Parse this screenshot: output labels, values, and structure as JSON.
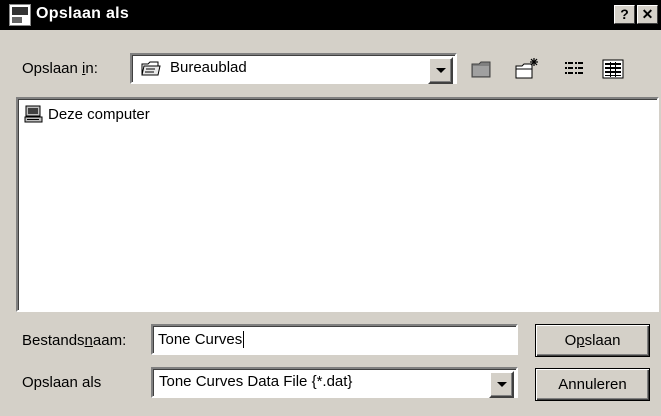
{
  "window": {
    "title": "Opslaan als",
    "help_glyph": "?",
    "close_glyph": "✕"
  },
  "location": {
    "label_pre": "Opslaan ",
    "label_mnemonic": "i",
    "label_post": "n:",
    "value": "Bureaublad"
  },
  "file_list": {
    "items": [
      {
        "label": "Deze computer",
        "icon": "computer-icon"
      }
    ]
  },
  "filename": {
    "label_pre": "Bestands",
    "label_mnemonic": "n",
    "label_post": "aam:",
    "value": "Tone Curves"
  },
  "filetype": {
    "label": "Opslaan als",
    "value": "Tone Curves Data File {*.dat}"
  },
  "buttons": {
    "save_pre": "O",
    "save_mnemonic": "p",
    "save_post": "slaan",
    "cancel": "Annuleren"
  },
  "icons": [
    "app-icon",
    "folder-desktop-icon",
    "up-folder-icon",
    "new-folder-icon",
    "list-view-icon",
    "details-view-icon",
    "computer-icon",
    "chevron-down-icon"
  ]
}
